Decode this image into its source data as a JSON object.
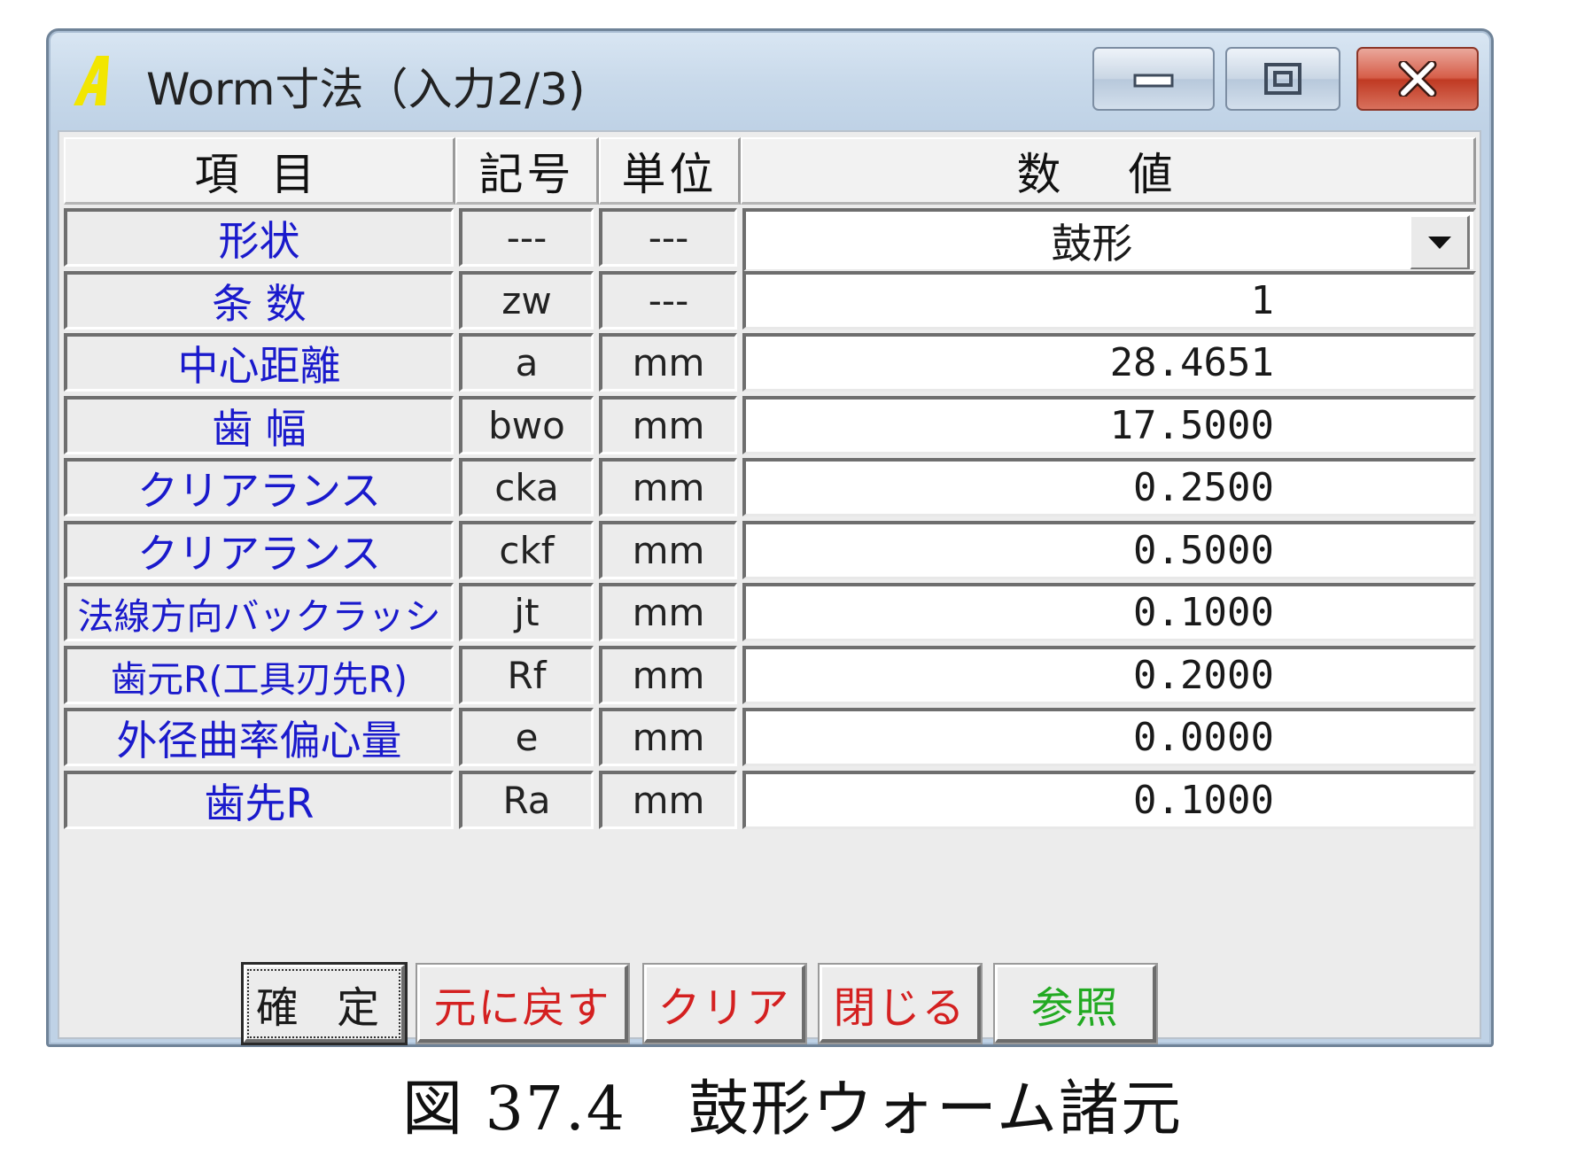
{
  "window": {
    "title": "Worm寸法（入力2/3)"
  },
  "table": {
    "headers": {
      "item": "項 目",
      "symbol": "記号",
      "unit": "単位",
      "value": "数 値"
    },
    "rows": [
      {
        "label": "形状",
        "symbol": "---",
        "unit": "---",
        "value": "鼓形",
        "type": "select"
      },
      {
        "label": "条 数",
        "symbol": "zw",
        "unit": "---",
        "value": "1",
        "type": "input"
      },
      {
        "label": "中心距離",
        "symbol": "a",
        "unit": "mm",
        "value": "28.4651",
        "type": "input"
      },
      {
        "label": "歯 幅",
        "symbol": "bwo",
        "unit": "mm",
        "value": "17.5000",
        "type": "input"
      },
      {
        "label": "クリアランス",
        "symbol": "cka",
        "unit": "mm",
        "value": "0.2500",
        "type": "input"
      },
      {
        "label": "クリアランス",
        "symbol": "ckf",
        "unit": "mm",
        "value": "0.5000",
        "type": "input"
      },
      {
        "label": "法線方向バックラッシ",
        "symbol": "jt",
        "unit": "mm",
        "value": "0.1000",
        "type": "input"
      },
      {
        "label": "歯元R(工具刃先R)",
        "symbol": "Rf",
        "unit": "mm",
        "value": "0.2000",
        "type": "input"
      },
      {
        "label": "外径曲率偏心量",
        "symbol": "e",
        "unit": "mm",
        "value": "0.0000",
        "type": "input"
      },
      {
        "label": "歯先R",
        "symbol": "Ra",
        "unit": "mm",
        "value": "0.1000",
        "type": "input"
      }
    ]
  },
  "buttons": {
    "confirm": "確 定",
    "revert": "元に戻す",
    "clear": "クリア",
    "close": "閉じる",
    "reference": "参照"
  },
  "colors": {
    "label_text": "#1a1acc",
    "revert_text": "#d42020",
    "clear_text": "#d42020",
    "close_text": "#d42020",
    "reference_text": "#22aa22",
    "close_button": "#c03a23",
    "app_icon": "#f2e600"
  },
  "caption": "図 37.4　鼓形ウォーム諸元"
}
